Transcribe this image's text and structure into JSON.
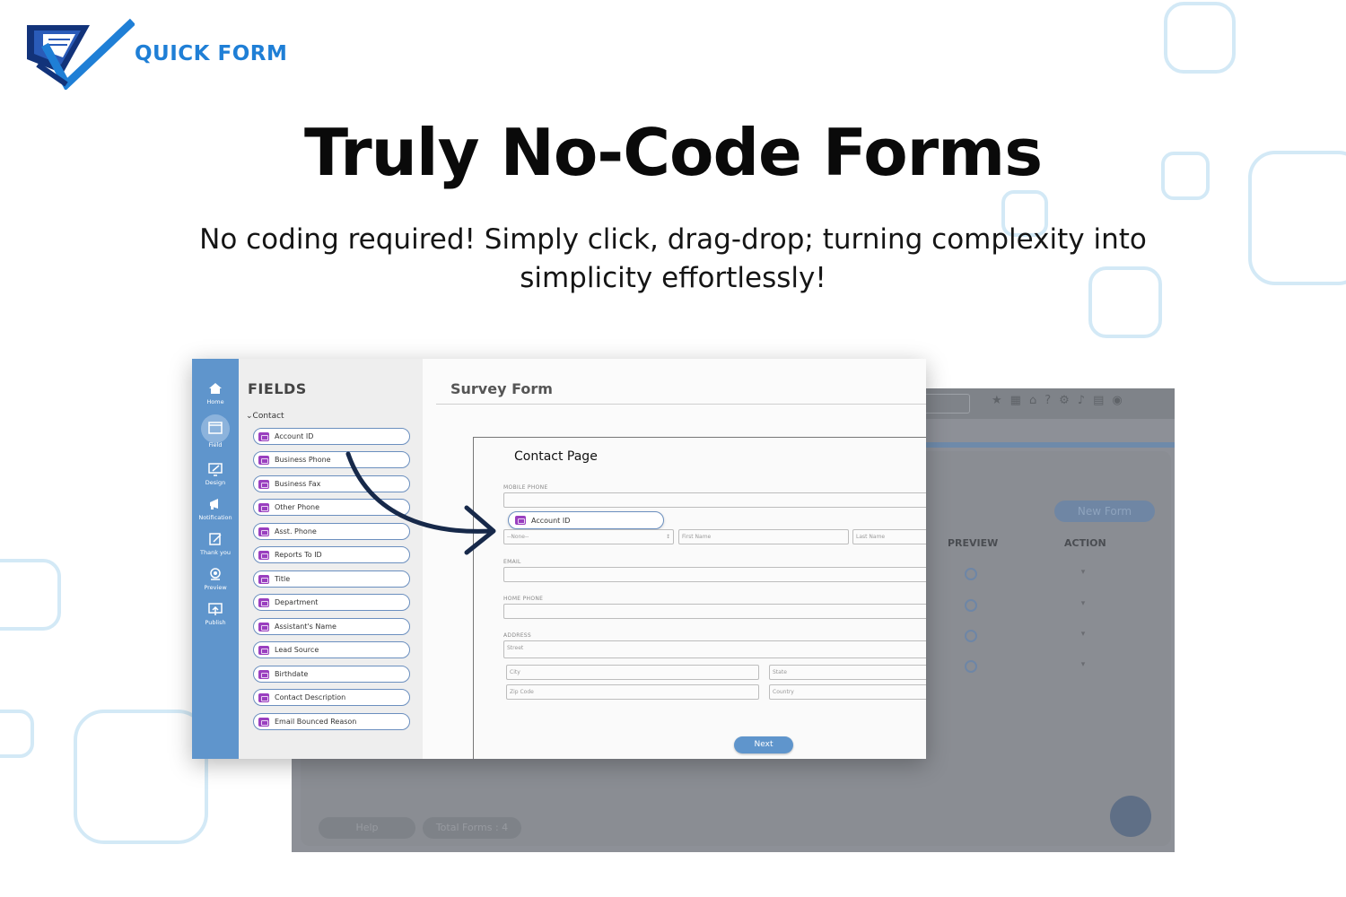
{
  "brand": {
    "name": "QUICK FORM"
  },
  "hero": {
    "headline": "Truly No-Code Forms",
    "subline": "No coding required! Simply click, drag-drop; turning complexity into simplicity effortlessly!"
  },
  "background_app": {
    "new_form": "New Form",
    "columns": [
      "PREVIEW",
      "ACTION"
    ],
    "rows": 4,
    "help": "Help",
    "total_forms": "Total Forms : 4"
  },
  "nav": {
    "items": [
      {
        "label": "Home",
        "icon": "home-icon"
      },
      {
        "label": "Field",
        "icon": "field-icon",
        "active": true
      },
      {
        "label": "Design",
        "icon": "design-icon"
      },
      {
        "label": "Notification",
        "icon": "megaphone-icon"
      },
      {
        "label": "Thank you",
        "icon": "thank-you-icon"
      },
      {
        "label": "Preview",
        "icon": "preview-icon"
      },
      {
        "label": "Publish",
        "icon": "publish-icon"
      }
    ]
  },
  "fields_panel": {
    "title": "FIELDS",
    "group": "Contact",
    "items": [
      "Account ID",
      "Business Phone",
      "Business Fax",
      "Other Phone",
      "Asst. Phone",
      "Reports To ID",
      "Title",
      "Department",
      "Assistant's Name",
      "Lead Source",
      "Birthdate",
      "Contact Description",
      "Email Bounced Reason"
    ]
  },
  "canvas": {
    "title": "Survey Form",
    "page_title": "Contact Page",
    "mobile_phone_label": "MOBILE PHONE",
    "dragged_field": "Account ID",
    "salutation_placeholder": "--None--",
    "first_name_placeholder": "First Name",
    "last_name_placeholder": "Last Name",
    "email_label": "EMAIL",
    "home_phone_label": "HOME PHONE",
    "address_label": "ADDRESS",
    "street_placeholder": "Street",
    "city_placeholder": "City",
    "state_placeholder": "State",
    "zip_placeholder": "Zip Code",
    "country_placeholder": "Country",
    "next_label": "Next"
  },
  "colors": {
    "brand_blue": "#1f7fd6",
    "rail_blue": "#5f95cc",
    "chip_purple": "#9a3fbf",
    "deco": "#d3e9f6"
  }
}
